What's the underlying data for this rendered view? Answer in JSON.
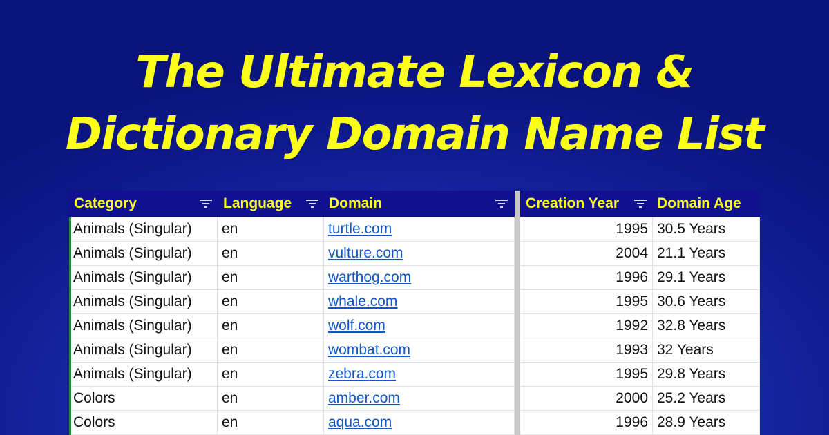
{
  "headline": {
    "line1": "The Ultimate Lexicon &",
    "line2": "Dictionary Domain Name List"
  },
  "colors": {
    "headline": "#fcff1a",
    "header_bg": "#11118f",
    "link": "#1155cc",
    "background": "#1a2cb0"
  },
  "table": {
    "headers": [
      "Category",
      "Language",
      "Domain",
      "Creation Year",
      "Domain Age"
    ],
    "filter_icon": "filter-icon",
    "rows": [
      {
        "category": "Animals (Singular)",
        "language": "en",
        "domain": "turtle.com",
        "year": "1995",
        "age": "30.5 Years"
      },
      {
        "category": "Animals (Singular)",
        "language": "en",
        "domain": "vulture.com",
        "year": "2004",
        "age": "21.1 Years"
      },
      {
        "category": "Animals (Singular)",
        "language": "en",
        "domain": "warthog.com",
        "year": "1996",
        "age": "29.1 Years"
      },
      {
        "category": "Animals (Singular)",
        "language": "en",
        "domain": "whale.com",
        "year": "1995",
        "age": "30.6 Years"
      },
      {
        "category": "Animals (Singular)",
        "language": "en",
        "domain": "wolf.com",
        "year": "1992",
        "age": "32.8 Years"
      },
      {
        "category": "Animals (Singular)",
        "language": "en",
        "domain": "wombat.com",
        "year": "1993",
        "age": "32 Years"
      },
      {
        "category": "Animals (Singular)",
        "language": "en",
        "domain": "zebra.com",
        "year": "1995",
        "age": "29.8 Years"
      },
      {
        "category": "Colors",
        "language": "en",
        "domain": "amber.com",
        "year": "2000",
        "age": "25.2 Years"
      },
      {
        "category": "Colors",
        "language": "en",
        "domain": "aqua.com",
        "year": "1996",
        "age": "28.9 Years"
      }
    ]
  }
}
